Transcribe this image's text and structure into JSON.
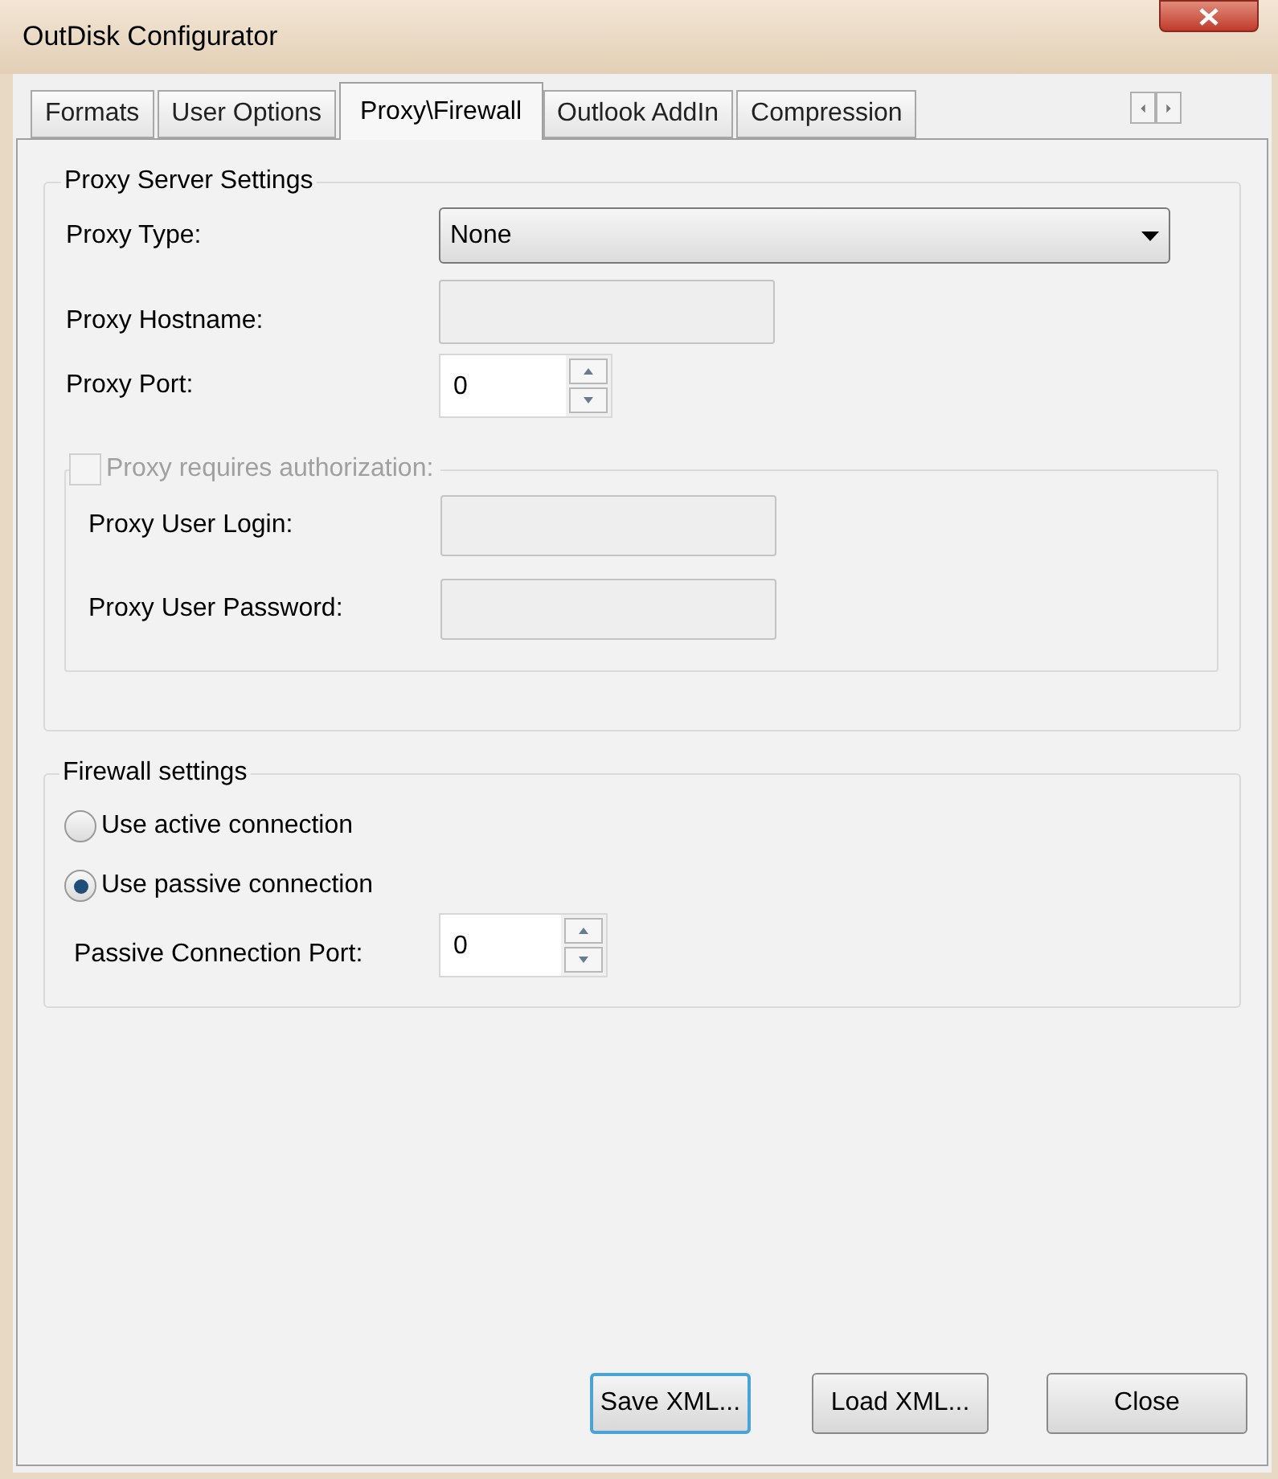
{
  "window": {
    "title": "OutDisk Configurator"
  },
  "tabs": [
    {
      "label": "Formats",
      "selected": false
    },
    {
      "label": "User Options",
      "selected": false
    },
    {
      "label": "Proxy\\Firewall",
      "selected": true
    },
    {
      "label": "Outlook AddIn",
      "selected": false
    },
    {
      "label": "Compression",
      "selected": false
    }
  ],
  "proxy_group": {
    "title": "Proxy Server Settings",
    "fields": [
      {
        "kind": "dropdown",
        "label": "Proxy Type:",
        "value": "None"
      },
      {
        "kind": "text",
        "label": "Proxy Hostname:"
      },
      {
        "kind": "spinner",
        "label": "Proxy Port:",
        "value": "0"
      }
    ],
    "auth": {
      "label": "Proxy requires authorization:",
      "checked": false,
      "disabled": true,
      "fields": [
        {
          "label": "Proxy User Login:"
        },
        {
          "label": "Proxy User Password:"
        }
      ]
    }
  },
  "firewall_group": {
    "title": "Firewall settings",
    "options": [
      {
        "label": "Use active connection",
        "selected": false
      },
      {
        "label": "Use passive connection",
        "selected": true
      }
    ],
    "port": {
      "label": "Passive Connection Port:",
      "value": "0"
    }
  },
  "buttons": [
    {
      "label": "Save XML...",
      "focused": true
    },
    {
      "label": "Load XML...",
      "focused": false
    },
    {
      "label": "Close",
      "focused": false
    }
  ]
}
